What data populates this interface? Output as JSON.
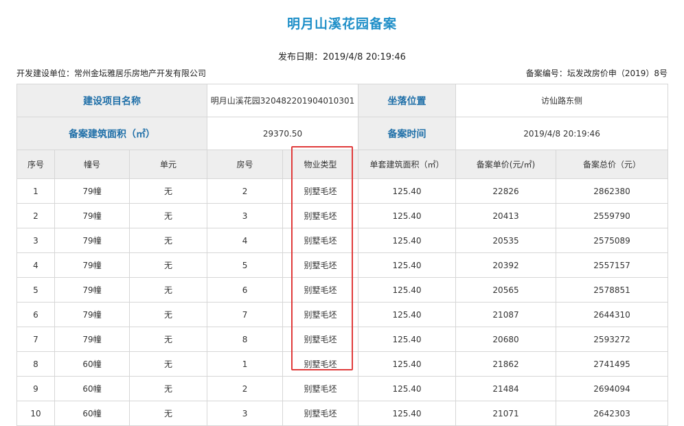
{
  "header": {
    "title": "明月山溪花园备案",
    "publish_label": "发布日期：",
    "publish_value": "2019/4/8 20:19:46",
    "developer_label": "开发建设单位：",
    "developer_value": "常州金坛雅居乐房地产开发有限公司",
    "record_no_label": "备案编号：",
    "record_no_value": "坛发改房价申（2019）8号"
  },
  "project": {
    "name_label": "建设项目名称",
    "name_value": "明月山溪花园320482201904010301",
    "location_label": "坐落位置",
    "location_value": "访仙路东侧",
    "area_label": "备案建筑面积（㎡）",
    "area_value": "29370.50",
    "time_label": "备案时间",
    "time_value": "2019/4/8 20:19:46"
  },
  "table": {
    "columns": [
      "序号",
      "幢号",
      "单元",
      "房号",
      "物业类型",
      "单套建筑面积（㎡）",
      "备案单价(元/㎡)",
      "备案总价（元）"
    ],
    "rows": [
      [
        "1",
        "79幢",
        "无",
        "2",
        "别墅毛坯",
        "125.40",
        "22826",
        "2862380"
      ],
      [
        "2",
        "79幢",
        "无",
        "3",
        "别墅毛坯",
        "125.40",
        "20413",
        "2559790"
      ],
      [
        "3",
        "79幢",
        "无",
        "4",
        "别墅毛坯",
        "125.40",
        "20535",
        "2575089"
      ],
      [
        "4",
        "79幢",
        "无",
        "5",
        "别墅毛坯",
        "125.40",
        "20392",
        "2557157"
      ],
      [
        "5",
        "79幢",
        "无",
        "6",
        "别墅毛坯",
        "125.40",
        "20565",
        "2578851"
      ],
      [
        "6",
        "79幢",
        "无",
        "7",
        "别墅毛坯",
        "125.40",
        "21087",
        "2644310"
      ],
      [
        "7",
        "79幢",
        "无",
        "8",
        "别墅毛坯",
        "125.40",
        "20680",
        "2593272"
      ],
      [
        "8",
        "60幢",
        "无",
        "1",
        "别墅毛坯",
        "125.40",
        "21862",
        "2741495"
      ],
      [
        "9",
        "60幢",
        "无",
        "2",
        "别墅毛坯",
        "125.40",
        "21484",
        "2694094"
      ],
      [
        "10",
        "60幢",
        "无",
        "3",
        "别墅毛坯",
        "125.40",
        "21071",
        "2642303"
      ]
    ]
  },
  "highlight_color": "#e03a3a",
  "accent_color": "#1f8fc8"
}
